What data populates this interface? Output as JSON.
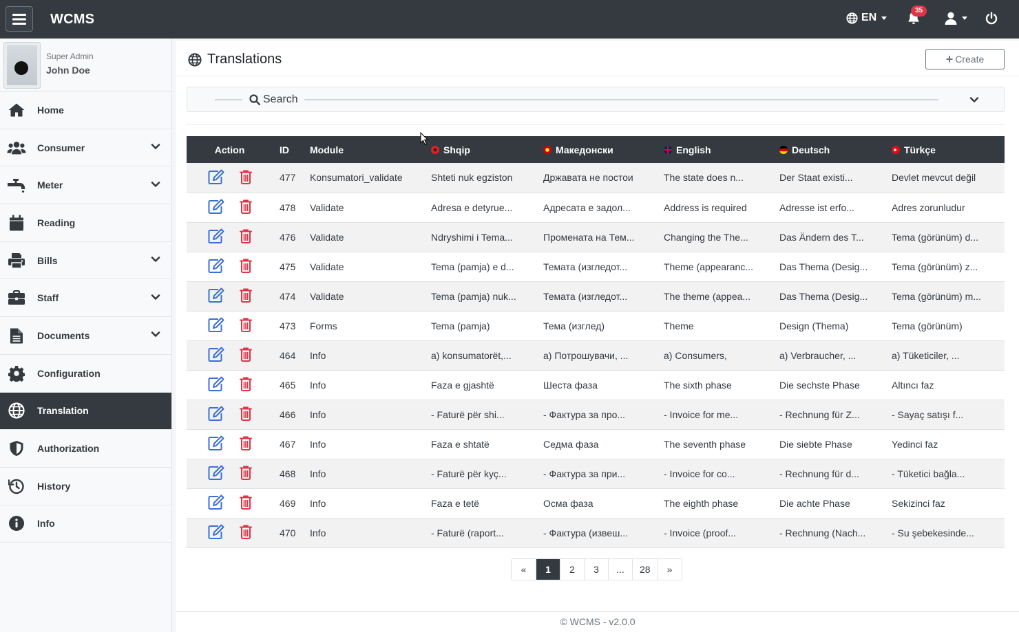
{
  "app": {
    "brand": "WCMS"
  },
  "nav": {
    "language": "EN",
    "notifications_count": "35"
  },
  "user": {
    "role": "Super Admin",
    "name": "John Doe"
  },
  "sidebar": {
    "items": [
      {
        "label": "Home",
        "icon": "home-icon",
        "expandable": false
      },
      {
        "label": "Consumer",
        "icon": "users-icon",
        "expandable": true
      },
      {
        "label": "Meter",
        "icon": "faucet-icon",
        "expandable": true
      },
      {
        "label": "Reading",
        "icon": "calendar-check-icon",
        "expandable": false
      },
      {
        "label": "Bills",
        "icon": "print-icon",
        "expandable": true
      },
      {
        "label": "Staff",
        "icon": "briefcase-icon",
        "expandable": true
      },
      {
        "label": "Documents",
        "icon": "file-icon",
        "expandable": true
      },
      {
        "label": "Configuration",
        "icon": "gear-icon",
        "expandable": false
      },
      {
        "label": "Translation",
        "icon": "globe-icon",
        "expandable": false,
        "active": true
      },
      {
        "label": "Authorization",
        "icon": "shield-icon",
        "expandable": false
      },
      {
        "label": "History",
        "icon": "history-icon",
        "expandable": false
      },
      {
        "label": "Info",
        "icon": "info-icon",
        "expandable": false
      }
    ]
  },
  "page": {
    "title": "Translations",
    "create_label": "Create",
    "search_label": "Search"
  },
  "table": {
    "headers": {
      "action": "Action",
      "id": "ID",
      "module": "Module",
      "sq": "Shqip",
      "mk": "Македонски",
      "en": "English",
      "de": "Deutsch",
      "tr": "Türkçe"
    },
    "rows": [
      {
        "id": "477",
        "module": "Konsumatori_validate",
        "sq": "Shteti nuk egziston",
        "mk": "Државата не постои",
        "en": "The state does n...",
        "de": "Der Staat existi...",
        "tr": "Devlet mevcut değil"
      },
      {
        "id": "478",
        "module": "Validate",
        "sq": "Adresa e detyrue...",
        "mk": "Адресата е задол...",
        "en": "Address is required",
        "de": "Adresse ist erfo...",
        "tr": "Adres zorunludur"
      },
      {
        "id": "476",
        "module": "Validate",
        "sq": "Ndryshimi i Tema...",
        "mk": "Промената на Тем...",
        "en": "Changing the The...",
        "de": "Das Ändern des T...",
        "tr": "Tema (görünüm) d..."
      },
      {
        "id": "475",
        "module": "Validate",
        "sq": "Tema (pamja) e d...",
        "mk": "Темата (изгледот...",
        "en": "Theme (appearanc...",
        "de": "Das Thema (Desig...",
        "tr": "Tema (görünüm) z..."
      },
      {
        "id": "474",
        "module": "Validate",
        "sq": "Tema (pamja) nuk...",
        "mk": "Темата (изгледот...",
        "en": "The theme (appea...",
        "de": "Das Thema (Desig...",
        "tr": "Tema (görünüm) m..."
      },
      {
        "id": "473",
        "module": "Forms",
        "sq": "Tema (pamja)",
        "mk": "Тема (изглед)",
        "en": "Theme",
        "de": "Design (Thema)",
        "tr": "Tema (görünüm)"
      },
      {
        "id": "464",
        "module": "Info",
        "sq": "a) konsumatorët,...",
        "mk": "а) Потрошувачи, ...",
        "en": "a) Consumers,",
        "de": "a) Verbraucher, ...",
        "tr": "a) Tüketiciler, ..."
      },
      {
        "id": "465",
        "module": "Info",
        "sq": "Faza e gjashtë",
        "mk": "Шеста фаза",
        "en": "The sixth phase",
        "de": "Die sechste Phase",
        "tr": "Altıncı faz"
      },
      {
        "id": "466",
        "module": "Info",
        "sq": "- Faturë për shi...",
        "mk": "- Фактура за про...",
        "en": "- Invoice for me...",
        "de": "- Rechnung für Z...",
        "tr": "- Sayaç satışı f..."
      },
      {
        "id": "467",
        "module": "Info",
        "sq": "Faza e shtatë",
        "mk": "Седма фаза",
        "en": "The seventh phase",
        "de": "Die siebte Phase",
        "tr": "Yedinci faz"
      },
      {
        "id": "468",
        "module": "Info",
        "sq": "- Faturë për kyç...",
        "mk": "- Фактура за при...",
        "en": "- Invoice for co...",
        "de": "- Rechnung für d...",
        "tr": "- Tüketici bağla..."
      },
      {
        "id": "469",
        "module": "Info",
        "sq": "Faza e tetë",
        "mk": "Осма фаза",
        "en": "The eighth phase",
        "de": "Die achte Phase",
        "tr": "Sekizinci faz"
      },
      {
        "id": "470",
        "module": "Info",
        "sq": "- Faturë (raport...",
        "mk": "- Фактура (извеш...",
        "en": "- Invoice (proof...",
        "de": "- Rechnung (Nach...",
        "tr": "- Su şebekesinde..."
      }
    ]
  },
  "pagination": {
    "items": [
      "«",
      "1",
      "2",
      "3",
      "...",
      "28",
      "»"
    ],
    "current": "1"
  },
  "footer": {
    "text": "© WCMS - v2.0.0"
  },
  "colors": {
    "navbar": "#343a40",
    "edit": "#3b6fd4",
    "delete": "#dc3545",
    "badge": "#dc3545"
  }
}
